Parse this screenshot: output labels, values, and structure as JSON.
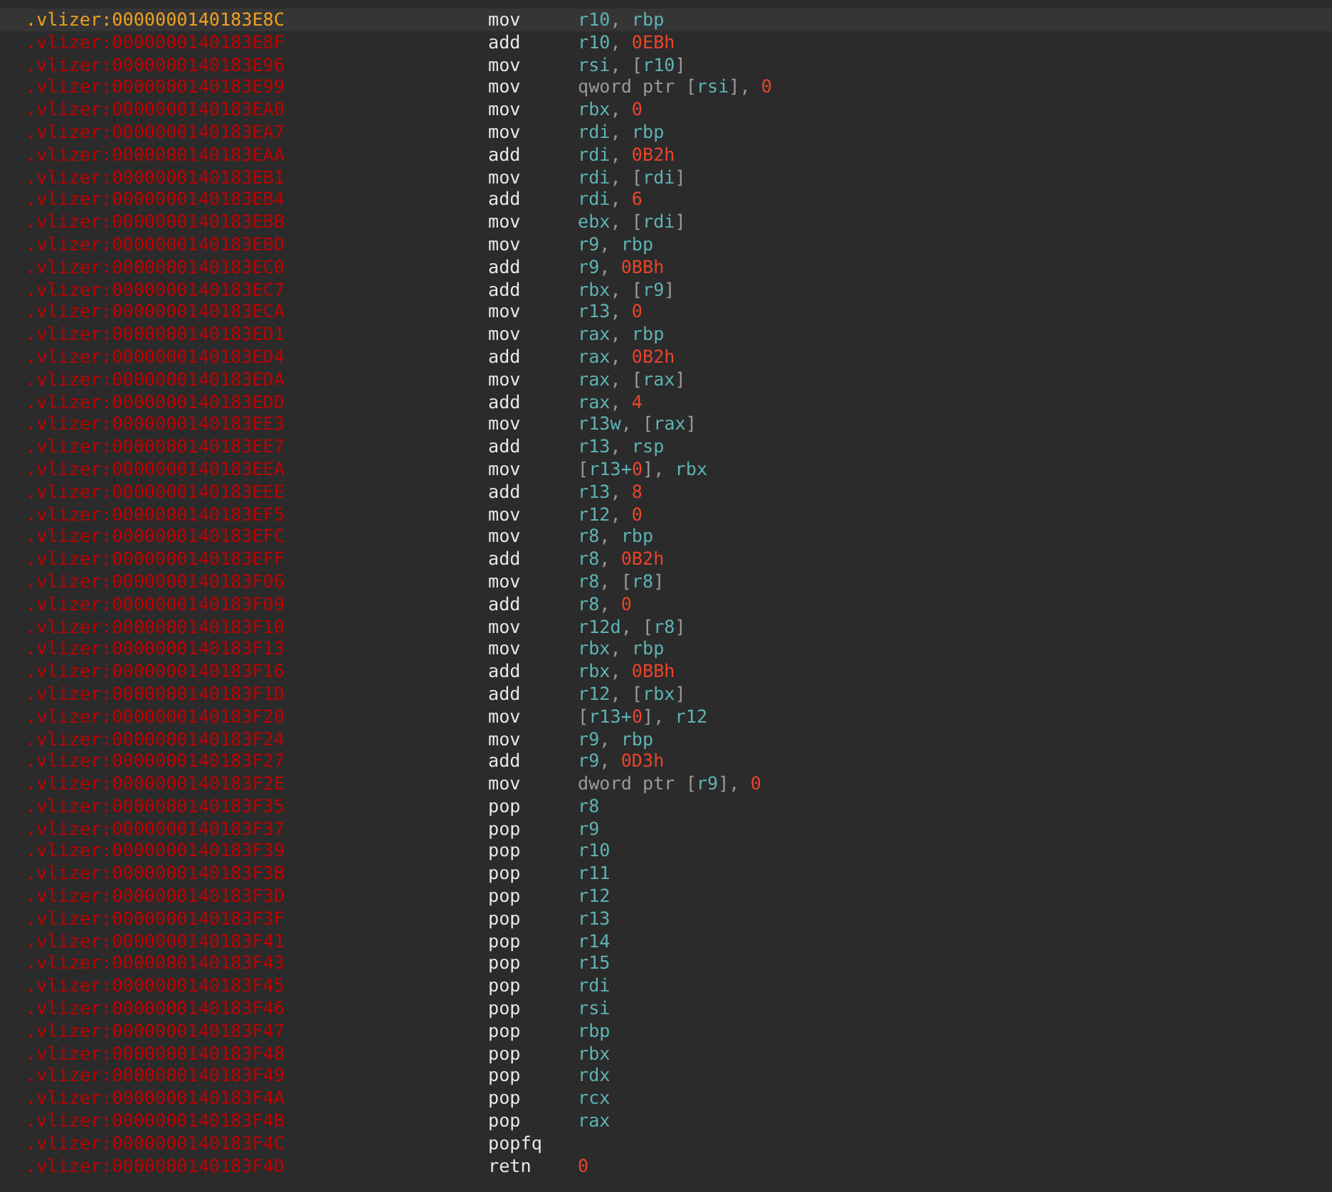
{
  "listing": {
    "rows": [
      {
        "address": ".vlizer:0000000140183E8C",
        "mnemonic": "mov",
        "selected": true,
        "operands": [
          {
            "text": "r10",
            "kind": "reg"
          },
          {
            "text": ", ",
            "kind": "plain"
          },
          {
            "text": "rbp",
            "kind": "reg"
          }
        ]
      },
      {
        "address": ".vlizer:0000000140183E8F",
        "mnemonic": "add",
        "selected": false,
        "operands": [
          {
            "text": "r10",
            "kind": "reg"
          },
          {
            "text": ", ",
            "kind": "plain"
          },
          {
            "text": "0EBh",
            "kind": "num"
          }
        ]
      },
      {
        "address": ".vlizer:0000000140183E96",
        "mnemonic": "mov",
        "selected": false,
        "operands": [
          {
            "text": "rsi",
            "kind": "reg"
          },
          {
            "text": ", [",
            "kind": "plain"
          },
          {
            "text": "r10",
            "kind": "reg"
          },
          {
            "text": "]",
            "kind": "plain"
          }
        ]
      },
      {
        "address": ".vlizer:0000000140183E99",
        "mnemonic": "mov",
        "selected": false,
        "operands": [
          {
            "text": "qword ptr [",
            "kind": "plain"
          },
          {
            "text": "rsi",
            "kind": "reg"
          },
          {
            "text": "], ",
            "kind": "plain"
          },
          {
            "text": "0",
            "kind": "num"
          }
        ]
      },
      {
        "address": ".vlizer:0000000140183EA0",
        "mnemonic": "mov",
        "selected": false,
        "operands": [
          {
            "text": "rbx",
            "kind": "reg"
          },
          {
            "text": ", ",
            "kind": "plain"
          },
          {
            "text": "0",
            "kind": "num"
          }
        ]
      },
      {
        "address": ".vlizer:0000000140183EA7",
        "mnemonic": "mov",
        "selected": false,
        "operands": [
          {
            "text": "rdi",
            "kind": "reg"
          },
          {
            "text": ", ",
            "kind": "plain"
          },
          {
            "text": "rbp",
            "kind": "reg"
          }
        ]
      },
      {
        "address": ".vlizer:0000000140183EAA",
        "mnemonic": "add",
        "selected": false,
        "operands": [
          {
            "text": "rdi",
            "kind": "reg"
          },
          {
            "text": ", ",
            "kind": "plain"
          },
          {
            "text": "0B2h",
            "kind": "num"
          }
        ]
      },
      {
        "address": ".vlizer:0000000140183EB1",
        "mnemonic": "mov",
        "selected": false,
        "operands": [
          {
            "text": "rdi",
            "kind": "reg"
          },
          {
            "text": ", [",
            "kind": "plain"
          },
          {
            "text": "rdi",
            "kind": "reg"
          },
          {
            "text": "]",
            "kind": "plain"
          }
        ]
      },
      {
        "address": ".vlizer:0000000140183EB4",
        "mnemonic": "add",
        "selected": false,
        "operands": [
          {
            "text": "rdi",
            "kind": "reg"
          },
          {
            "text": ", ",
            "kind": "plain"
          },
          {
            "text": "6",
            "kind": "num"
          }
        ]
      },
      {
        "address": ".vlizer:0000000140183EBB",
        "mnemonic": "mov",
        "selected": false,
        "operands": [
          {
            "text": "ebx",
            "kind": "reg"
          },
          {
            "text": ", [",
            "kind": "plain"
          },
          {
            "text": "rdi",
            "kind": "reg"
          },
          {
            "text": "]",
            "kind": "plain"
          }
        ]
      },
      {
        "address": ".vlizer:0000000140183EBD",
        "mnemonic": "mov",
        "selected": false,
        "operands": [
          {
            "text": "r9",
            "kind": "reg"
          },
          {
            "text": ", ",
            "kind": "plain"
          },
          {
            "text": "rbp",
            "kind": "reg"
          }
        ]
      },
      {
        "address": ".vlizer:0000000140183EC0",
        "mnemonic": "add",
        "selected": false,
        "operands": [
          {
            "text": "r9",
            "kind": "reg"
          },
          {
            "text": ", ",
            "kind": "plain"
          },
          {
            "text": "0BBh",
            "kind": "num"
          }
        ]
      },
      {
        "address": ".vlizer:0000000140183EC7",
        "mnemonic": "add",
        "selected": false,
        "operands": [
          {
            "text": "rbx",
            "kind": "reg"
          },
          {
            "text": ", [",
            "kind": "plain"
          },
          {
            "text": "r9",
            "kind": "reg"
          },
          {
            "text": "]",
            "kind": "plain"
          }
        ]
      },
      {
        "address": ".vlizer:0000000140183ECA",
        "mnemonic": "mov",
        "selected": false,
        "operands": [
          {
            "text": "r13",
            "kind": "reg"
          },
          {
            "text": ", ",
            "kind": "plain"
          },
          {
            "text": "0",
            "kind": "num"
          }
        ]
      },
      {
        "address": ".vlizer:0000000140183ED1",
        "mnemonic": "mov",
        "selected": false,
        "operands": [
          {
            "text": "rax",
            "kind": "reg"
          },
          {
            "text": ", ",
            "kind": "plain"
          },
          {
            "text": "rbp",
            "kind": "reg"
          }
        ]
      },
      {
        "address": ".vlizer:0000000140183ED4",
        "mnemonic": "add",
        "selected": false,
        "operands": [
          {
            "text": "rax",
            "kind": "reg"
          },
          {
            "text": ", ",
            "kind": "plain"
          },
          {
            "text": "0B2h",
            "kind": "num"
          }
        ]
      },
      {
        "address": ".vlizer:0000000140183EDA",
        "mnemonic": "mov",
        "selected": false,
        "operands": [
          {
            "text": "rax",
            "kind": "reg"
          },
          {
            "text": ", [",
            "kind": "plain"
          },
          {
            "text": "rax",
            "kind": "reg"
          },
          {
            "text": "]",
            "kind": "plain"
          }
        ]
      },
      {
        "address": ".vlizer:0000000140183EDD",
        "mnemonic": "add",
        "selected": false,
        "operands": [
          {
            "text": "rax",
            "kind": "reg"
          },
          {
            "text": ", ",
            "kind": "plain"
          },
          {
            "text": "4",
            "kind": "num"
          }
        ]
      },
      {
        "address": ".vlizer:0000000140183EE3",
        "mnemonic": "mov",
        "selected": false,
        "operands": [
          {
            "text": "r13w",
            "kind": "reg"
          },
          {
            "text": ", [",
            "kind": "plain"
          },
          {
            "text": "rax",
            "kind": "reg"
          },
          {
            "text": "]",
            "kind": "plain"
          }
        ]
      },
      {
        "address": ".vlizer:0000000140183EE7",
        "mnemonic": "add",
        "selected": false,
        "operands": [
          {
            "text": "r13",
            "kind": "reg"
          },
          {
            "text": ", ",
            "kind": "plain"
          },
          {
            "text": "rsp",
            "kind": "reg"
          }
        ]
      },
      {
        "address": ".vlizer:0000000140183EEA",
        "mnemonic": "mov",
        "selected": false,
        "operands": [
          {
            "text": "[",
            "kind": "plain"
          },
          {
            "text": "r13+",
            "kind": "reg"
          },
          {
            "text": "0",
            "kind": "num"
          },
          {
            "text": "], ",
            "kind": "plain"
          },
          {
            "text": "rbx",
            "kind": "reg"
          }
        ]
      },
      {
        "address": ".vlizer:0000000140183EEE",
        "mnemonic": "add",
        "selected": false,
        "operands": [
          {
            "text": "r13",
            "kind": "reg"
          },
          {
            "text": ", ",
            "kind": "plain"
          },
          {
            "text": "8",
            "kind": "num"
          }
        ]
      },
      {
        "address": ".vlizer:0000000140183EF5",
        "mnemonic": "mov",
        "selected": false,
        "operands": [
          {
            "text": "r12",
            "kind": "reg"
          },
          {
            "text": ", ",
            "kind": "plain"
          },
          {
            "text": "0",
            "kind": "num"
          }
        ]
      },
      {
        "address": ".vlizer:0000000140183EFC",
        "mnemonic": "mov",
        "selected": false,
        "operands": [
          {
            "text": "r8",
            "kind": "reg"
          },
          {
            "text": ", ",
            "kind": "plain"
          },
          {
            "text": "rbp",
            "kind": "reg"
          }
        ]
      },
      {
        "address": ".vlizer:0000000140183EFF",
        "mnemonic": "add",
        "selected": false,
        "operands": [
          {
            "text": "r8",
            "kind": "reg"
          },
          {
            "text": ", ",
            "kind": "plain"
          },
          {
            "text": "0B2h",
            "kind": "num"
          }
        ]
      },
      {
        "address": ".vlizer:0000000140183F06",
        "mnemonic": "mov",
        "selected": false,
        "operands": [
          {
            "text": "r8",
            "kind": "reg"
          },
          {
            "text": ", [",
            "kind": "plain"
          },
          {
            "text": "r8",
            "kind": "reg"
          },
          {
            "text": "]",
            "kind": "plain"
          }
        ]
      },
      {
        "address": ".vlizer:0000000140183F09",
        "mnemonic": "add",
        "selected": false,
        "operands": [
          {
            "text": "r8",
            "kind": "reg"
          },
          {
            "text": ", ",
            "kind": "plain"
          },
          {
            "text": "0",
            "kind": "num"
          }
        ]
      },
      {
        "address": ".vlizer:0000000140183F10",
        "mnemonic": "mov",
        "selected": false,
        "operands": [
          {
            "text": "r12d",
            "kind": "reg"
          },
          {
            "text": ", [",
            "kind": "plain"
          },
          {
            "text": "r8",
            "kind": "reg"
          },
          {
            "text": "]",
            "kind": "plain"
          }
        ]
      },
      {
        "address": ".vlizer:0000000140183F13",
        "mnemonic": "mov",
        "selected": false,
        "operands": [
          {
            "text": "rbx",
            "kind": "reg"
          },
          {
            "text": ", ",
            "kind": "plain"
          },
          {
            "text": "rbp",
            "kind": "reg"
          }
        ]
      },
      {
        "address": ".vlizer:0000000140183F16",
        "mnemonic": "add",
        "selected": false,
        "operands": [
          {
            "text": "rbx",
            "kind": "reg"
          },
          {
            "text": ", ",
            "kind": "plain"
          },
          {
            "text": "0BBh",
            "kind": "num"
          }
        ]
      },
      {
        "address": ".vlizer:0000000140183F1D",
        "mnemonic": "add",
        "selected": false,
        "operands": [
          {
            "text": "r12",
            "kind": "reg"
          },
          {
            "text": ", [",
            "kind": "plain"
          },
          {
            "text": "rbx",
            "kind": "reg"
          },
          {
            "text": "]",
            "kind": "plain"
          }
        ]
      },
      {
        "address": ".vlizer:0000000140183F20",
        "mnemonic": "mov",
        "selected": false,
        "operands": [
          {
            "text": "[",
            "kind": "plain"
          },
          {
            "text": "r13+",
            "kind": "reg"
          },
          {
            "text": "0",
            "kind": "num"
          },
          {
            "text": "], ",
            "kind": "plain"
          },
          {
            "text": "r12",
            "kind": "reg"
          }
        ]
      },
      {
        "address": ".vlizer:0000000140183F24",
        "mnemonic": "mov",
        "selected": false,
        "operands": [
          {
            "text": "r9",
            "kind": "reg"
          },
          {
            "text": ", ",
            "kind": "plain"
          },
          {
            "text": "rbp",
            "kind": "reg"
          }
        ]
      },
      {
        "address": ".vlizer:0000000140183F27",
        "mnemonic": "add",
        "selected": false,
        "operands": [
          {
            "text": "r9",
            "kind": "reg"
          },
          {
            "text": ", ",
            "kind": "plain"
          },
          {
            "text": "0D3h",
            "kind": "num"
          }
        ]
      },
      {
        "address": ".vlizer:0000000140183F2E",
        "mnemonic": "mov",
        "selected": false,
        "operands": [
          {
            "text": "dword ptr [",
            "kind": "plain"
          },
          {
            "text": "r9",
            "kind": "reg"
          },
          {
            "text": "], ",
            "kind": "plain"
          },
          {
            "text": "0",
            "kind": "num"
          }
        ]
      },
      {
        "address": ".vlizer:0000000140183F35",
        "mnemonic": "pop",
        "selected": false,
        "operands": [
          {
            "text": "r8",
            "kind": "reg"
          }
        ]
      },
      {
        "address": ".vlizer:0000000140183F37",
        "mnemonic": "pop",
        "selected": false,
        "operands": [
          {
            "text": "r9",
            "kind": "reg"
          }
        ]
      },
      {
        "address": ".vlizer:0000000140183F39",
        "mnemonic": "pop",
        "selected": false,
        "operands": [
          {
            "text": "r10",
            "kind": "reg"
          }
        ]
      },
      {
        "address": ".vlizer:0000000140183F3B",
        "mnemonic": "pop",
        "selected": false,
        "operands": [
          {
            "text": "r11",
            "kind": "reg"
          }
        ]
      },
      {
        "address": ".vlizer:0000000140183F3D",
        "mnemonic": "pop",
        "selected": false,
        "operands": [
          {
            "text": "r12",
            "kind": "reg"
          }
        ]
      },
      {
        "address": ".vlizer:0000000140183F3F",
        "mnemonic": "pop",
        "selected": false,
        "operands": [
          {
            "text": "r13",
            "kind": "reg"
          }
        ]
      },
      {
        "address": ".vlizer:0000000140183F41",
        "mnemonic": "pop",
        "selected": false,
        "operands": [
          {
            "text": "r14",
            "kind": "reg"
          }
        ]
      },
      {
        "address": ".vlizer:0000000140183F43",
        "mnemonic": "pop",
        "selected": false,
        "operands": [
          {
            "text": "r15",
            "kind": "reg"
          }
        ]
      },
      {
        "address": ".vlizer:0000000140183F45",
        "mnemonic": "pop",
        "selected": false,
        "operands": [
          {
            "text": "rdi",
            "kind": "reg"
          }
        ]
      },
      {
        "address": ".vlizer:0000000140183F46",
        "mnemonic": "pop",
        "selected": false,
        "operands": [
          {
            "text": "rsi",
            "kind": "reg"
          }
        ]
      },
      {
        "address": ".vlizer:0000000140183F47",
        "mnemonic": "pop",
        "selected": false,
        "operands": [
          {
            "text": "rbp",
            "kind": "reg"
          }
        ]
      },
      {
        "address": ".vlizer:0000000140183F48",
        "mnemonic": "pop",
        "selected": false,
        "operands": [
          {
            "text": "rbx",
            "kind": "reg"
          }
        ]
      },
      {
        "address": ".vlizer:0000000140183F49",
        "mnemonic": "pop",
        "selected": false,
        "operands": [
          {
            "text": "rdx",
            "kind": "reg"
          }
        ]
      },
      {
        "address": ".vlizer:0000000140183F4A",
        "mnemonic": "pop",
        "selected": false,
        "operands": [
          {
            "text": "rcx",
            "kind": "reg"
          }
        ]
      },
      {
        "address": ".vlizer:0000000140183F4B",
        "mnemonic": "pop",
        "selected": false,
        "operands": [
          {
            "text": "rax",
            "kind": "reg"
          }
        ]
      },
      {
        "address": ".vlizer:0000000140183F4C",
        "mnemonic": "popfq",
        "selected": false,
        "operands": []
      },
      {
        "address": ".vlizer:0000000140183F4D",
        "mnemonic": "retn",
        "selected": false,
        "operands": [
          {
            "text": "0",
            "kind": "num"
          }
        ]
      }
    ]
  }
}
